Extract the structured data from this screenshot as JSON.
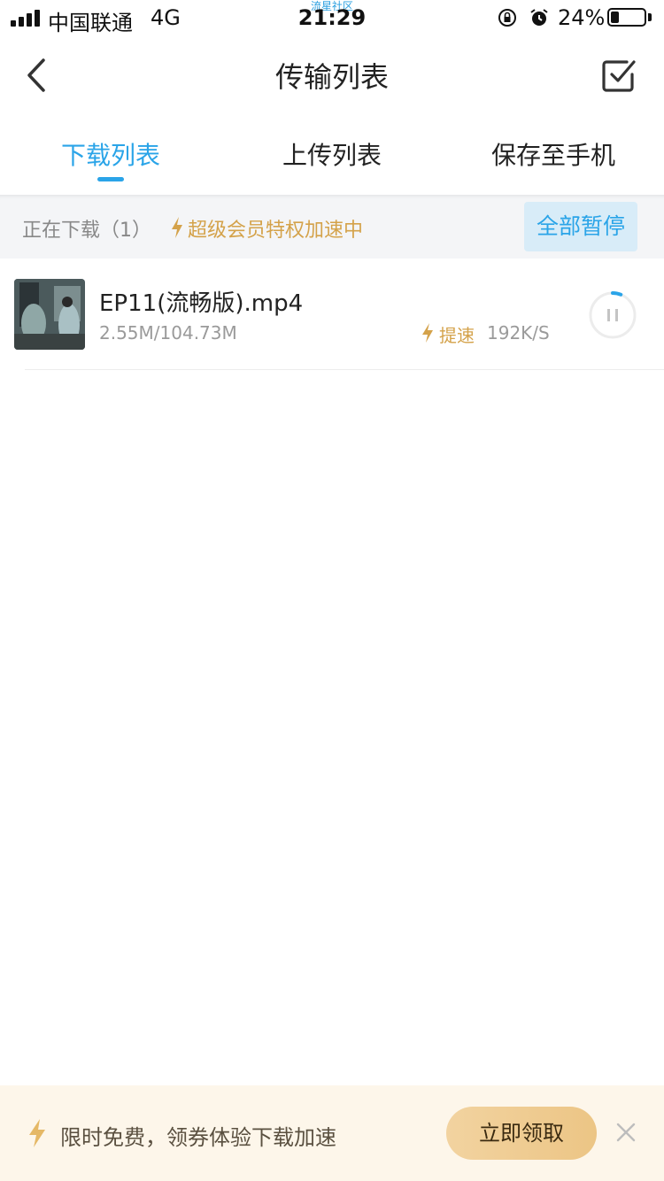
{
  "status_bar": {
    "carrier": "中国联通",
    "network": "4G",
    "community_tag": "流星社区",
    "time": "21:29",
    "battery": "24%",
    "battery_level": 0.24
  },
  "nav": {
    "title": "传输列表",
    "back_icon": "chevron-left-icon",
    "edit_icon": "checkbox-edit-icon"
  },
  "tabs": [
    {
      "label": "下载列表",
      "active": true
    },
    {
      "label": "上传列表",
      "active": false
    },
    {
      "label": "保存至手机",
      "active": false
    }
  ],
  "banner": {
    "downloading": "正在下载（1）",
    "vip_text": "超级会员特权加速中",
    "pause_all": "全部暂停"
  },
  "item": {
    "filename": "EP11(流畅版).mp4",
    "size": "2.55M/104.73M",
    "speedup": "提速",
    "speed": "192K/S",
    "progress": 0.024
  },
  "footer": {
    "promo": "限时免费，领券体验下载加速",
    "claim": "立即领取"
  },
  "colors": {
    "accent": "#2aa4e8",
    "gold": "#d4a24a",
    "footer_bg": "#fdf6ea"
  }
}
